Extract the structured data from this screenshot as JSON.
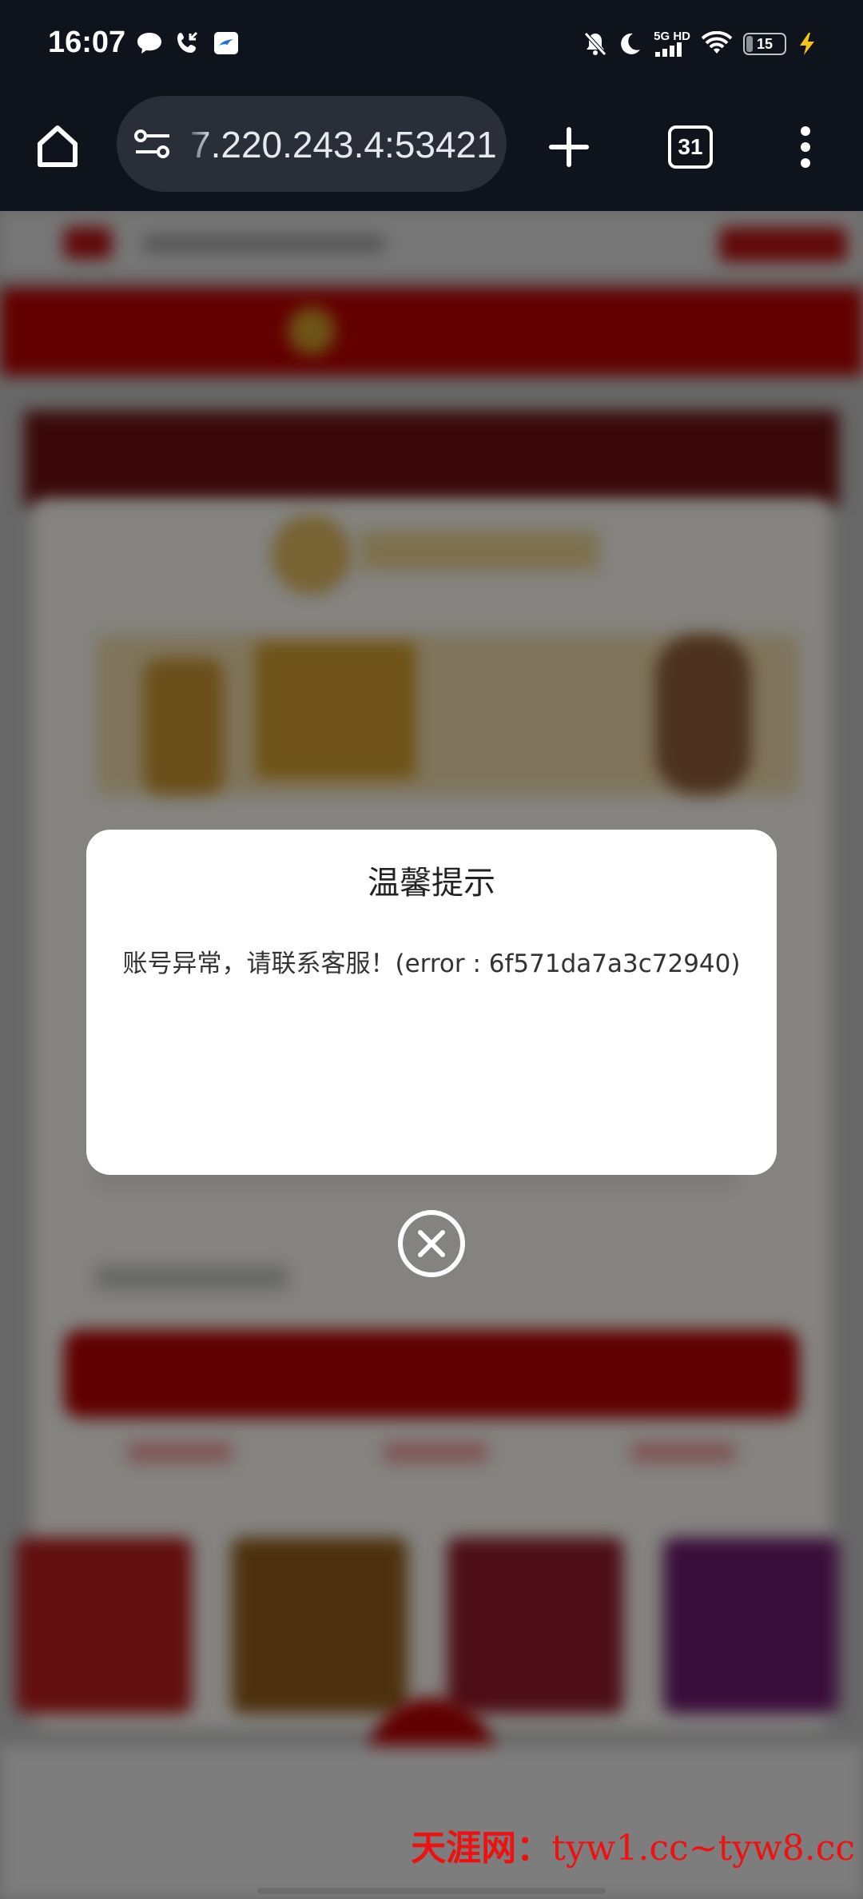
{
  "status_bar": {
    "time": "16:07",
    "network": "5G HD",
    "battery_level": "15"
  },
  "browser": {
    "url": "7.220.243.4:53421",
    "tab_count": "31"
  },
  "dialog": {
    "title": "温馨提示",
    "message": "账号异常，请联系客服！(error : 6f571da7a3c72940)"
  },
  "watermark": {
    "brand": "天涯网：",
    "domains": "tyw1.cc~tyw8.cc"
  },
  "colors": {
    "status_bg": "#0f131c",
    "urlbar_bg": "#2a2e38",
    "page_red": "#b00000",
    "watermark_red": "#ee1111"
  },
  "icons": [
    "message-icon",
    "call-icon",
    "app-notification-icon",
    "bell-off-icon",
    "moon-icon",
    "signal-icon",
    "wifi-icon",
    "battery-icon",
    "charging-icon",
    "home-icon",
    "site-settings-icon",
    "plus-icon",
    "tabs-icon",
    "more-vertical-icon",
    "close-circle-icon"
  ]
}
